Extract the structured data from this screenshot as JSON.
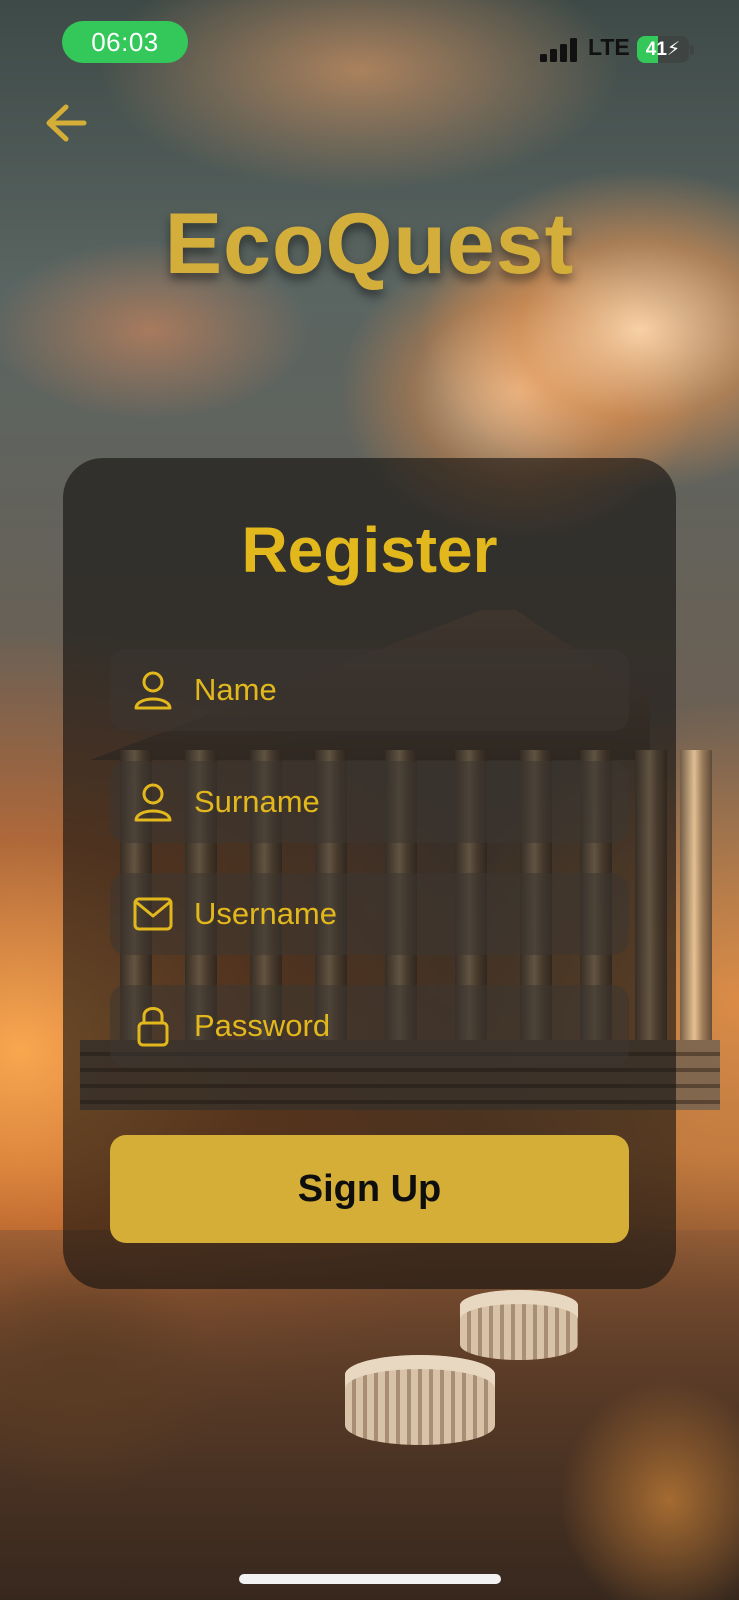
{
  "status_bar": {
    "time": "06:03",
    "network": "LTE",
    "battery_level": "41",
    "battery_percent": 41
  },
  "header": {
    "back_icon": "arrow-left-icon",
    "app_title": "EcoQuest"
  },
  "form": {
    "title": "Register",
    "fields": [
      {
        "label": "Name",
        "icon": "user-icon"
      },
      {
        "label": "Surname",
        "icon": "user-icon"
      },
      {
        "label": "Username",
        "icon": "mail-icon"
      },
      {
        "label": "Password",
        "icon": "lock-icon"
      }
    ],
    "submit_label": "Sign Up"
  },
  "colors": {
    "accent": "#d4ae37",
    "label": "#e2b81c",
    "status_green": "#34c759"
  }
}
